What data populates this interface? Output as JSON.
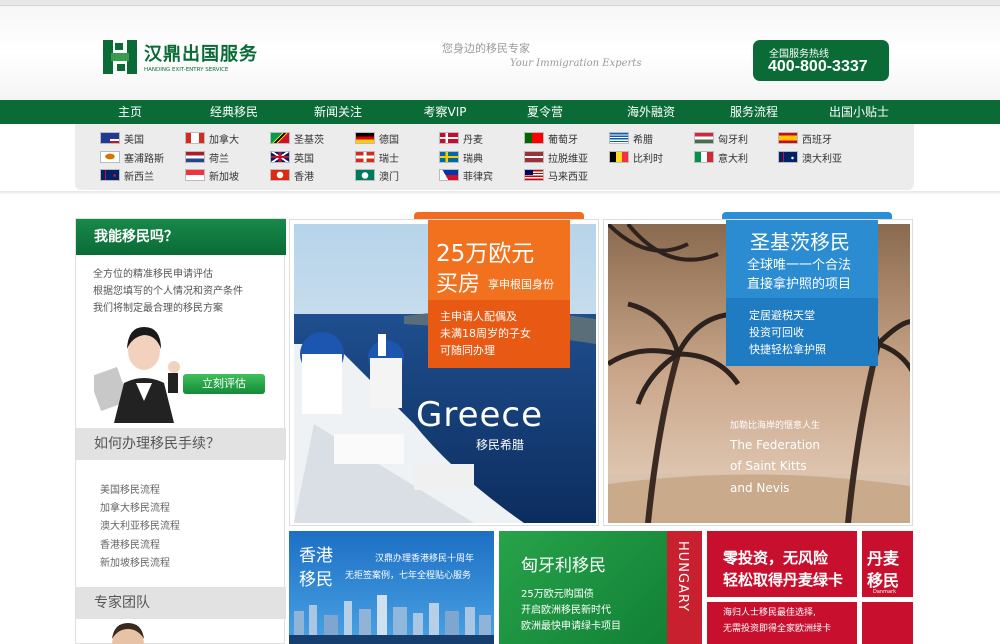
{
  "header": {
    "logo_name": "汉鼎出国服务",
    "logo_en": "HANDING EXIT-ENTRY SERVICE",
    "slogan_cn": "您身边的移民专家",
    "slogan_en": "Your Immigration Experts",
    "hotline_label": "全国服务热线",
    "hotline_number": "400-800-3337"
  },
  "nav": [
    "主页",
    "经典移民",
    "新闻关注",
    "考察VIP",
    "夏令营",
    "海外融资",
    "服务流程",
    "出国小贴士"
  ],
  "countries": [
    [
      "美国",
      "加拿大",
      "圣基茨",
      "德国",
      "丹麦",
      "葡萄牙",
      "希腊",
      "匈牙利",
      "西班牙"
    ],
    [
      "塞浦路斯",
      "荷兰",
      "英国",
      "瑞士",
      "瑞典",
      "拉脱维亚",
      "比利时",
      "意大利",
      "澳大利亚"
    ],
    [
      "新西兰",
      "新加坡",
      "香港",
      "澳门",
      "菲律宾",
      "马来西亚"
    ]
  ],
  "sidebar": {
    "title": "我能移民吗？",
    "lines": [
      "全方位的精准移民申请评估",
      "根据您填写的个人情况和资产条件",
      "我们将制定最合理的移民方案"
    ],
    "eval_button": "立刻评估",
    "process_title": "如何办理移民手续？",
    "process_links": [
      "美国移民流程",
      "加拿大移民流程",
      "澳大利亚移民流程",
      "香港移民流程",
      "新加坡移民流程"
    ],
    "team_title": "专家团队"
  },
  "greece": {
    "price": "25万欧元",
    "house": "买房",
    "house_sub": "享申根国身份",
    "lines": [
      "主申请人配偶及",
      "未满18周岁的子女",
      "可随同办理"
    ],
    "big": "Greece",
    "sub": "移民希腊"
  },
  "stkitts": {
    "title": "圣基茨移民",
    "line1": "全球唯一一个合法",
    "line2": "直接拿护照的项目",
    "points": [
      "定居避税天堂",
      "投资可回收",
      "快捷轻松拿护照"
    ],
    "caption": "加勒比海岸的惬意人生",
    "en": [
      "The Federation",
      "of Saint Kitts",
      "and Nevis"
    ]
  },
  "hongkong": {
    "t1": "香港",
    "t2": "移民",
    "line1": "汉鼎办理香港移民十周年",
    "line2": "无拒签案例，七年全程贴心服务"
  },
  "hungary": {
    "title": "匈牙利移民",
    "vertical": "HUNGARY",
    "lines": [
      "25万欧元购国债",
      "开启欧洲移民新时代",
      "欧洲最快申请绿卡项目"
    ]
  },
  "denmark": {
    "line1": "零投资，无风险",
    "line2": "轻松取得丹麦绿卡",
    "badge1": "丹麦",
    "badge2": "移民",
    "badge_en": "Danmark",
    "note1": "海归人士移民最佳选择,",
    "note2": "无需投资即得全家欧洲绿卡"
  },
  "colors": {
    "brand": "#0a6b36",
    "accent_orange": "#f26b21",
    "accent_blue": "#2a8fd6",
    "accent_red": "#c8102e"
  }
}
